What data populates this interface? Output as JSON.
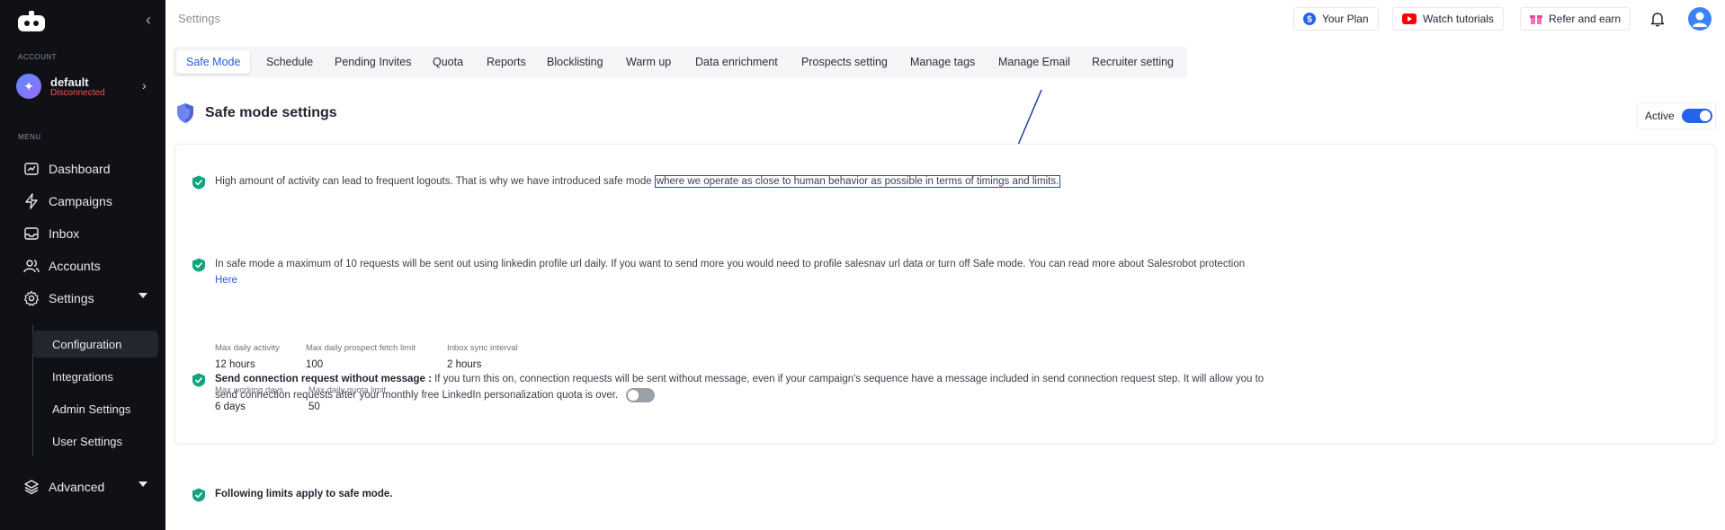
{
  "sidebar": {
    "account_section": "ACCOUNT",
    "account": {
      "name": "default",
      "status": "Disconnected",
      "avatar_icon": "sparkle-icon"
    },
    "menu_section": "MENU",
    "items": [
      {
        "label": "Dashboard",
        "icon": "dashboard-icon"
      },
      {
        "label": "Campaigns",
        "icon": "bolt-icon"
      },
      {
        "label": "Inbox",
        "icon": "inbox-icon"
      },
      {
        "label": "Accounts",
        "icon": "users-icon"
      },
      {
        "label": "Settings",
        "icon": "gear-icon"
      }
    ],
    "settings_sub": [
      "Configuration",
      "Integrations",
      "Admin Settings",
      "User Settings"
    ],
    "advanced": {
      "label": "Advanced",
      "icon": "layers-icon"
    }
  },
  "topbar": {
    "title": "Settings",
    "buttons": [
      {
        "label": "Your Plan",
        "icon": "dollar-icon"
      },
      {
        "label": "Watch tutorials",
        "icon": "youtube-icon"
      },
      {
        "label": "Refer and earn",
        "icon": "gift-icon"
      }
    ]
  },
  "tabs": [
    "Safe Mode",
    "Schedule",
    "Pending Invites",
    "Quota",
    "Reports",
    "Blocklisting",
    "Warm up",
    "Data enrichment",
    "Prospects setting",
    "Manage tags",
    "Manage Email",
    "Recruiter setting"
  ],
  "active_tab": "Safe Mode",
  "safe_mode": {
    "title": "Safe mode settings",
    "status_label": "Active",
    "status_on": true,
    "info1_part1": "High amount of activity can lead to frequent logouts. That is why we have introduced safe mode",
    "info1_highlight": "where we operate as close to human behavior as possible in terms of timings and limits.",
    "info2_part1": "In safe mode a maximum of 10 requests will be sent out using linkedin profile url daily. If you want to send more you would need to profile salesnav url data or turn off Safe mode. You can read more about Salesrobot protection",
    "info2_link": "Here",
    "info3_title": "Send connection request without message :",
    "info3_text": "If you turn this on, connection requests will be sent without message, even if your campaign's sequence have a message included in send connection request step. It will allow you to send connection requests after your monthly free LinkedIn personalization quota is over.",
    "info3_toggle_on": false,
    "limits_title": "Following limits apply to safe mode.",
    "limits": [
      {
        "label": "Max daily activity",
        "value": "12 hours"
      },
      {
        "label": "Max daily prospect fetch limit",
        "value": "100"
      },
      {
        "label": "Inbox sync interval",
        "value": "2 hours"
      },
      {
        "label": "Max working days",
        "value": "6 days"
      },
      {
        "label": "Max daily quota limit",
        "value": "50"
      }
    ]
  },
  "colors": {
    "accent": "#2563eb",
    "sidebar_bg": "#0f1117",
    "check": "#12a37f",
    "error": "#ff4d4f"
  }
}
